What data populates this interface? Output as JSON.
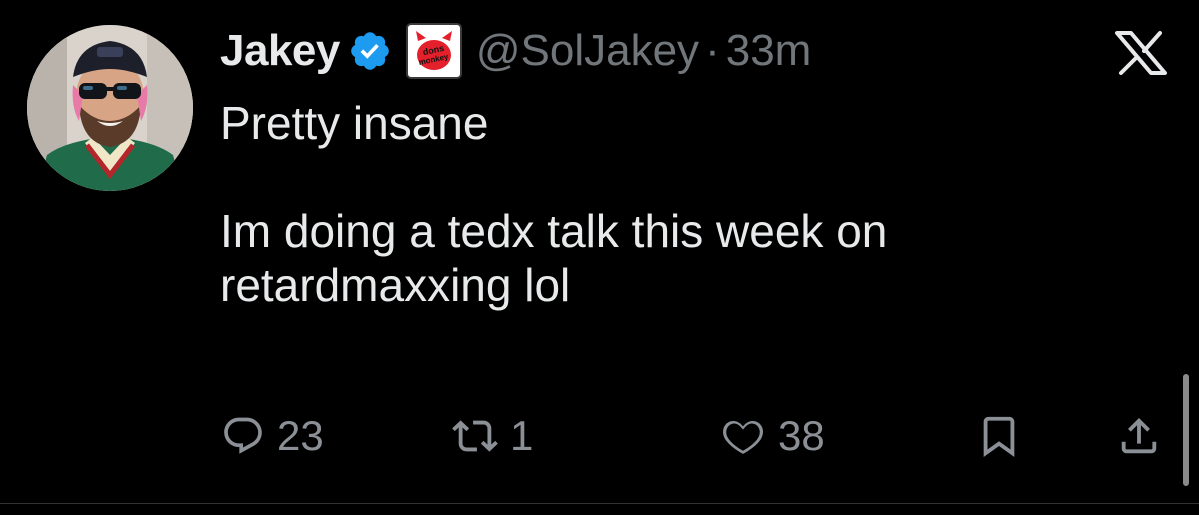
{
  "tweet": {
    "author": {
      "display_name": "Jakey",
      "handle": "@SolJakey",
      "verified": true,
      "affiliate_badge": "dons-monkey-badge-icon",
      "avatar": "avatar-icon"
    },
    "separator": "·",
    "time": "33m",
    "text_lines": [
      "Pretty insane",
      "",
      "Im doing a tedx talk this week on",
      "retardmaxxing lol"
    ],
    "actions": {
      "reply": {
        "icon": "reply-icon",
        "count": "23"
      },
      "repost": {
        "icon": "repost-icon",
        "count": "1"
      },
      "like": {
        "icon": "heart-icon",
        "count": "38"
      },
      "bookmark": {
        "icon": "bookmark-icon"
      },
      "share": {
        "icon": "share-icon"
      }
    }
  },
  "platform": {
    "logo": "x-logo-icon"
  },
  "colors": {
    "background": "#000000",
    "primary_text": "#e7e9ea",
    "secondary_text": "#71767b",
    "verified_blue": "#1d9bf0",
    "affiliate_red": "#e4202c"
  }
}
